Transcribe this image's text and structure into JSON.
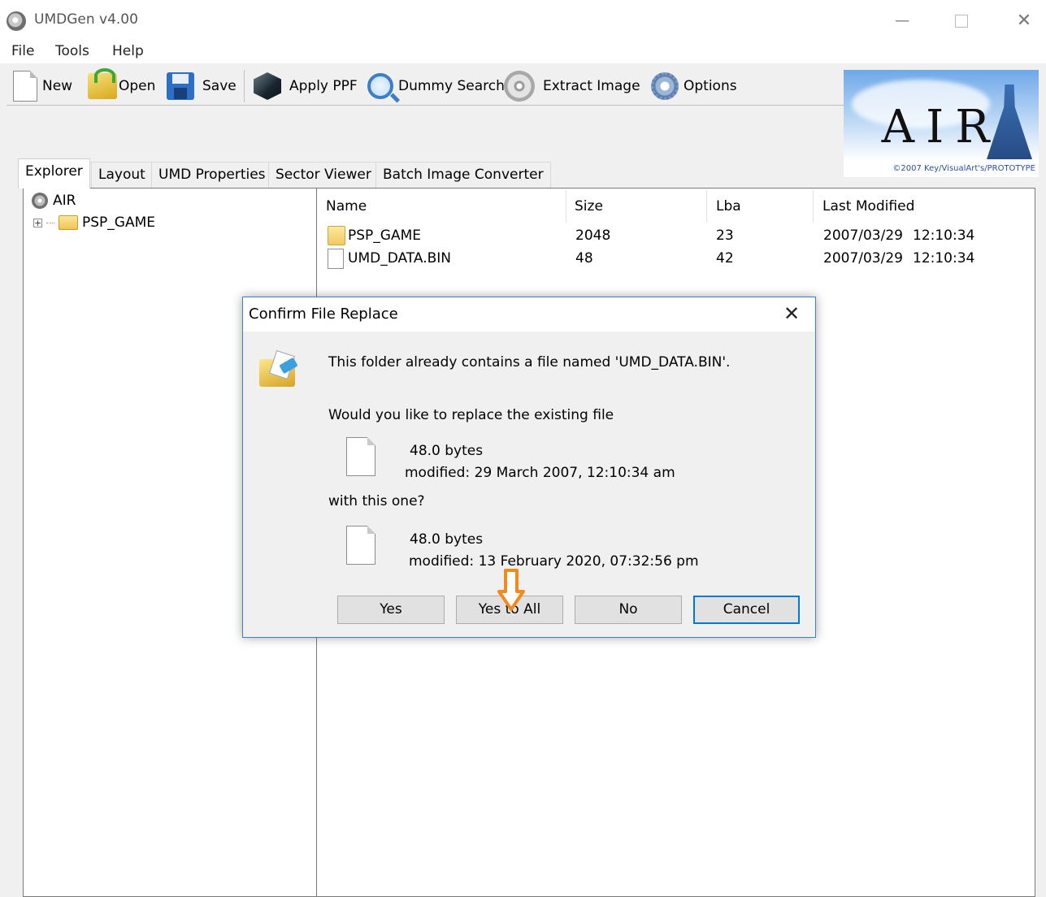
{
  "window": {
    "title": "UMDGen v4.00",
    "controls": {
      "minimize": "—",
      "maximize": "",
      "close": "✕"
    }
  },
  "menu": [
    "File",
    "Tools",
    "Help"
  ],
  "toolbar": {
    "new": "New",
    "open": "Open",
    "save": "Save",
    "apply_ppf": "Apply PPF",
    "dummy_search": "Dummy Search",
    "extract_image": "Extract Image",
    "options": "Options"
  },
  "logo": {
    "text": "AIR",
    "copyright": "©2007 Key/VisualArt's/PROTOTYPE"
  },
  "tabs": [
    "Explorer",
    "Layout",
    "UMD Properties",
    "Sector Viewer",
    "Batch Image Converter"
  ],
  "active_tab": "Explorer",
  "tree": {
    "root": "AIR",
    "children": [
      {
        "label": "PSP_GAME",
        "expander": "+"
      }
    ]
  },
  "file_list": {
    "columns": [
      "Name",
      "Size",
      "Lba",
      "Last Modified"
    ],
    "rows": [
      {
        "name": "PSP_GAME",
        "size": "2048",
        "lba": "23",
        "date": "2007/03/29",
        "time": "12:10:34",
        "icon": "folder-icon"
      },
      {
        "name": "UMD_DATA.BIN",
        "size": "48",
        "lba": "42",
        "date": "2007/03/29",
        "time": "12:10:34",
        "icon": "file-icon"
      }
    ]
  },
  "dialog": {
    "title": "Confirm File Replace",
    "close": "✕",
    "message": "This folder already contains a file named 'UMD_DATA.BIN'.",
    "question": "Would you like to replace the existing file",
    "existing": {
      "size": "48.0 bytes",
      "modified": "modified: 29 March 2007, 12:10:34 am"
    },
    "with_this": "with this one?",
    "new_file": {
      "size": "48.0 bytes",
      "modified": "modified: 13 February 2020, 07:32:56 pm"
    },
    "buttons": {
      "yes": "Yes",
      "yes_to_all": "Yes to All",
      "no": "No",
      "cancel": "Cancel"
    },
    "default_button": "Cancel"
  },
  "colors": {
    "accent": "#0078d7",
    "dialog_border": "#3d80d1",
    "annotation_arrow": "#f28a1c"
  }
}
